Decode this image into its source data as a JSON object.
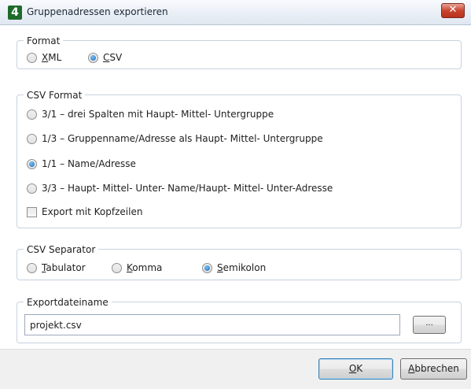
{
  "window": {
    "title": "Gruppenadressen exportieren",
    "app_icon_glyph": "4",
    "close_glyph": "✕"
  },
  "format": {
    "legend": "Format",
    "options": [
      {
        "accel": "X",
        "rest": "ML",
        "selected": false
      },
      {
        "accel": "C",
        "rest": "SV",
        "selected": true
      }
    ]
  },
  "csv_format": {
    "legend": "CSV Format",
    "options": [
      {
        "label": "3/1 – drei Spalten mit Haupt- Mittel- Untergruppe",
        "selected": false
      },
      {
        "label": "1/3 – Gruppenname/Adresse als Haupt- Mittel- Untergruppe",
        "selected": false
      },
      {
        "label": "1/1 – Name/Adresse",
        "selected": true
      },
      {
        "label": "3/3 – Haupt- Mittel- Unter- Name/Haupt- Mittel- Unter-Adresse",
        "selected": false
      }
    ],
    "header_checkbox": {
      "label": "Export mit Kopfzeilen",
      "checked": false
    }
  },
  "csv_separator": {
    "legend": "CSV Separator",
    "options": [
      {
        "accel": "T",
        "rest": "abulator",
        "selected": false
      },
      {
        "accel": "K",
        "rest": "omma",
        "selected": false
      },
      {
        "accel": "S",
        "rest": "emikolon",
        "selected": true
      }
    ]
  },
  "export_file": {
    "legend": "Exportdateiname",
    "value": "projekt.csv",
    "browse_label": "..."
  },
  "buttons": {
    "ok_accel": "O",
    "ok_rest": "K",
    "cancel_accel": "A",
    "cancel_rest": "bbrechen"
  },
  "colors": {
    "title_bar": "#dfe7f1",
    "close_button": "#c8442f",
    "radio_selected": "#1667b8",
    "group_border": "#c6d2df",
    "footer": "#f0f0f0"
  }
}
